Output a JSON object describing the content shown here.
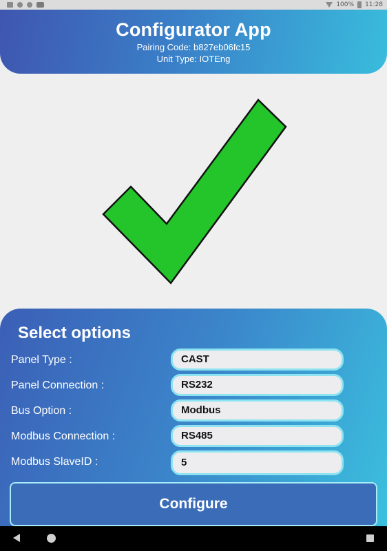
{
  "status_bar": {
    "battery_text": "100%",
    "time": "11:28",
    "icons": [
      "image-icon",
      "circle-icon",
      "circle-icon",
      "youtube-icon",
      "wifi-icon",
      "battery-icon"
    ]
  },
  "header": {
    "title": "Configurator App",
    "pairing_code": "Pairing Code: b827eb06fc15",
    "unit_type": "Unit Type: IOTEng"
  },
  "status_graphic": {
    "icon": "checkmark-icon",
    "fill_color": "#24c42b",
    "stroke_color": "#111111"
  },
  "options": {
    "title": "Select options",
    "rows": [
      {
        "label": "Panel Type :",
        "value": "CAST"
      },
      {
        "label": "Panel Connection :",
        "value": "RS232"
      },
      {
        "label": "Bus Option :",
        "value": "Modbus"
      },
      {
        "label": "Modbus Connection :",
        "value": "RS485"
      },
      {
        "label": "Modbus SlaveID :",
        "value": "5"
      }
    ]
  },
  "actions": {
    "configure_label": "Configure"
  },
  "nav_bar": {
    "icons": [
      "back-icon",
      "home-icon",
      "recents-icon"
    ]
  },
  "colors": {
    "accent_gradient_start": "#3f56b0",
    "accent_gradient_end": "#39bcdc",
    "button_fill": "#3a6cb8",
    "input_border": "#8de3f0"
  }
}
